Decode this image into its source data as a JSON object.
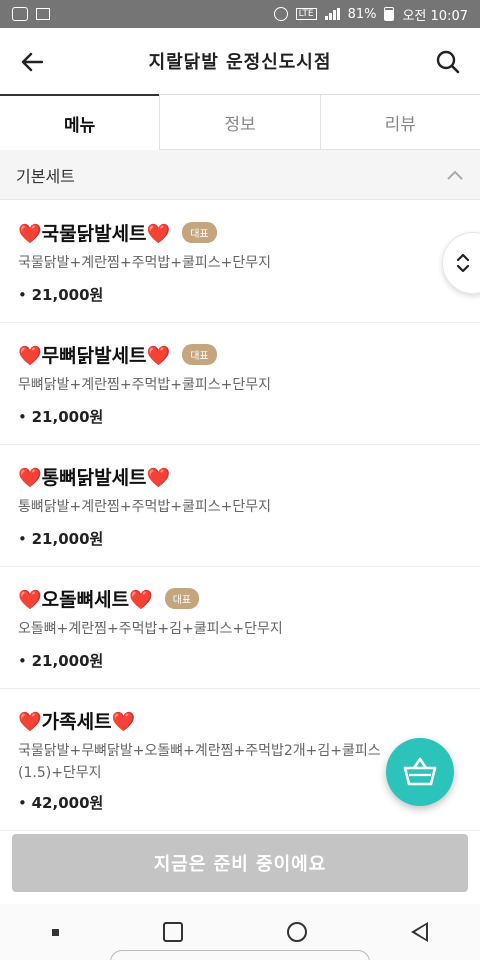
{
  "status_bar": {
    "battery": "81%",
    "time": "오전 10:07",
    "network": "LTE"
  },
  "header": {
    "title": "지랄닭발 운정신도시점"
  },
  "tabs": [
    {
      "label": "메뉴",
      "active": true
    },
    {
      "label": "정보",
      "active": false
    },
    {
      "label": "리뷰",
      "active": false
    }
  ],
  "section": {
    "title": "기본세트"
  },
  "menu_items": [
    {
      "name": "❤️국물닭발세트❤️",
      "badge": "대표",
      "desc": "국물닭발+계란찜+주먹밥+쿨피스+단무지",
      "price": "21,000원"
    },
    {
      "name": "❤️무뼈닭발세트❤️",
      "badge": "대표",
      "desc": "무뼈닭발+계란찜+주먹밥+쿨피스+단무지",
      "price": "21,000원"
    },
    {
      "name": "❤️통뼈닭발세트❤️",
      "badge": "",
      "desc": "통뼈닭발+계란찜+주먹밥+쿨피스+단무지",
      "price": "21,000원"
    },
    {
      "name": "❤️오돌뼈세트❤️",
      "badge": "대표",
      "desc": "오돌뼈+계란찜+주먹밥+김+쿨피스+단무지",
      "price": "21,000원"
    },
    {
      "name": "❤️가족세트❤️",
      "badge": "",
      "desc": "국물닭발+무뼈닭발+오돌뼈+계란찜+주먹밥2개+김+쿨피스(1.5)+단무지",
      "price": "42,000원"
    }
  ],
  "order_button": {
    "label": "지금은 준비 중이에요"
  },
  "colors": {
    "accent": "#2cc3bb",
    "badge": "#c4a57e",
    "disabled_button": "#c4c4c4"
  }
}
